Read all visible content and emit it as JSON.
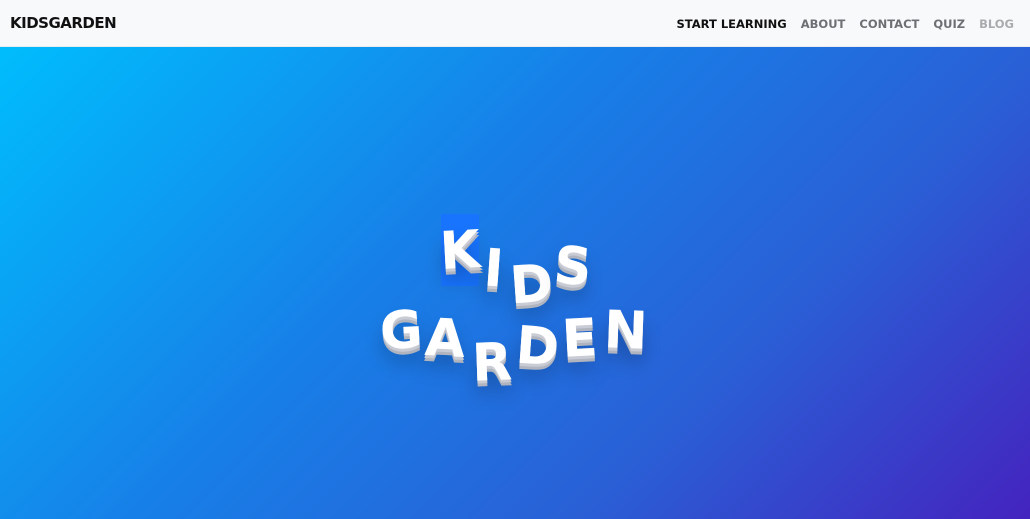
{
  "navbar": {
    "brand": "KIDSGARDEN",
    "links": [
      {
        "label": "START LEARNING"
      },
      {
        "label": "ABOUT"
      },
      {
        "label": "CONTACT"
      },
      {
        "label": "QUIZ"
      },
      {
        "label": "BLOG"
      }
    ]
  },
  "hero": {
    "logo_line1": [
      "K",
      "I",
      "D",
      "S"
    ],
    "logo_line2": [
      "G",
      "A",
      "R",
      "D",
      "E",
      "N"
    ]
  },
  "colors": {
    "hero_gradient_start": "#00bdfd",
    "hero_gradient_end": "#4423be",
    "logo_text": "#ffffff",
    "highlight": "#1872ff"
  }
}
